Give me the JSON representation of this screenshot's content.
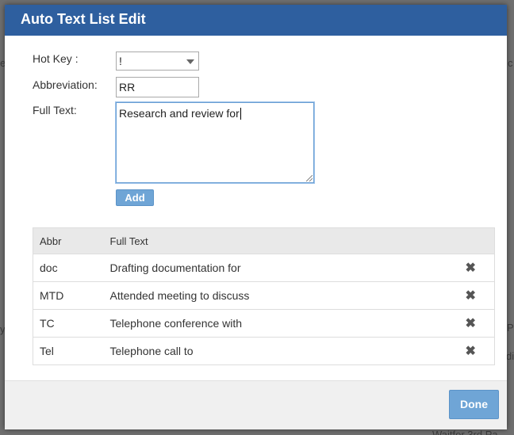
{
  "background": {
    "fragments": [
      "e",
      "c",
      "y",
      "P",
      "di",
      "Waitfor 3rd Pa"
    ]
  },
  "dialog": {
    "title": "Auto Text List Edit",
    "hotkey": {
      "label": "Hot Key :",
      "value": "!"
    },
    "abbreviation": {
      "label": "Abbreviation:",
      "value": "RR"
    },
    "full_text": {
      "label": "Full Text:",
      "value": "Research and review for"
    },
    "add_label": "Add",
    "table": {
      "headers": [
        "Abbr",
        "Full Text"
      ],
      "rows": [
        {
          "abbr": "doc",
          "text": "Drafting documentation for"
        },
        {
          "abbr": "MTD",
          "text": "Attended meeting to discuss"
        },
        {
          "abbr": "TC",
          "text": "Telephone conference with"
        },
        {
          "abbr": "Tel",
          "text": "Telephone call to"
        }
      ],
      "delete_icon": "close-x-icon"
    },
    "done_label": "Done"
  },
  "colors": {
    "titlebar": "#2e5f9f",
    "button": "#6fa5d6",
    "overlay": "#6f6f6f"
  }
}
